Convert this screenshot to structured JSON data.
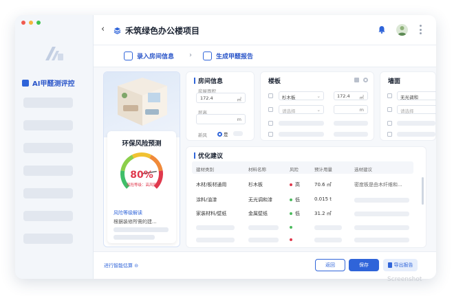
{
  "window": {
    "controls": [
      "#f05a4f",
      "#f5b43d",
      "#3fc24f"
    ]
  },
  "sidebar": {
    "brand": "AI甲醛测评控"
  },
  "header": {
    "back": "‹",
    "project_title": "禾筑绿色办公楼项目"
  },
  "steps": {
    "step1": "录入房间信息",
    "separator": "›",
    "step2": "生成甲醛报告"
  },
  "risk": {
    "title": "环保风险预测",
    "percent": "80%",
    "percent_value": 80,
    "level": "风险等级：高风险",
    "link": "风险等级解读",
    "desc": "根据装修所需的建..."
  },
  "room": {
    "title": "房间信息",
    "area_label": "房屋面积",
    "area_value": "172.4",
    "area_unit": "㎡",
    "height_label": "层高",
    "height_value": "",
    "height_unit": "m",
    "fresh_label": "新风",
    "fresh_yes": "是"
  },
  "floor": {
    "title": "楼板",
    "material": "杉木板",
    "area": "172.4",
    "area_unit": "㎡",
    "select_placeholder": "请选择",
    "unit_m": "m"
  },
  "wall": {
    "title": "墙面",
    "material": "无光调和",
    "select_placeholder": "请选择"
  },
  "suggest": {
    "title": "优化建议",
    "columns": [
      "建材类别",
      "材料名称",
      "风险",
      "预计用量",
      "选材建议"
    ],
    "rows": [
      {
        "category": "木材/板材通用",
        "name": "杉木板",
        "risk": "高",
        "risk_color": "#e0394d",
        "amount": "70.6 ㎡",
        "advice": "密度板是由木纤维和..."
      },
      {
        "category": "涂料/油漆",
        "name": "无光调和漆",
        "risk": "低",
        "risk_color": "#4cbb5e",
        "amount": "0.015 t",
        "advice": ""
      },
      {
        "category": "家装材料/壁纸",
        "name": "金属壁纸",
        "risk": "低",
        "risk_color": "#4cbb5e",
        "amount": "31.2 ㎡",
        "advice": ""
      }
    ]
  },
  "footer": {
    "smart_link": "进行智能估算 ⊝",
    "return": "返回",
    "save": "保存",
    "export": "导出报告"
  },
  "watermark": "Screenshot"
}
